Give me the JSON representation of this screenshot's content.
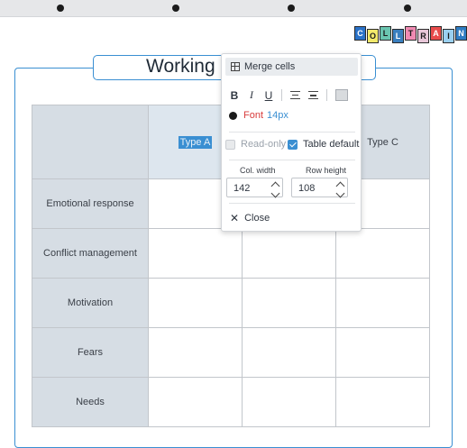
{
  "app": {
    "logo_letters": [
      {
        "ch": "C",
        "bg": "#2a72c8",
        "fg": "#ffffff"
      },
      {
        "ch": "O",
        "bg": "#f2e96b",
        "fg": "#1b1b1b"
      },
      {
        "ch": "L",
        "bg": "#6ac5b0",
        "fg": "#1b1b1b"
      },
      {
        "ch": "L",
        "bg": "#3a7fbf",
        "fg": "#ffffff"
      },
      {
        "ch": "T",
        "bg": "#f08ab2",
        "fg": "#1b1b1b"
      },
      {
        "ch": "R",
        "bg": "#e8c7d8",
        "fg": "#1b1b1b"
      },
      {
        "ch": "A",
        "bg": "#e84b4b",
        "fg": "#ffffff"
      },
      {
        "ch": "I",
        "bg": "#9ad0f0",
        "fg": "#1b1b1b"
      },
      {
        "ch": "N",
        "bg": "#2f7cc2",
        "fg": "#ffffff"
      }
    ]
  },
  "worksheet": {
    "title": "Working",
    "columns": [
      "",
      "Type A",
      "",
      "Type C"
    ],
    "rows": [
      {
        "label": "Emotional response"
      },
      {
        "label": "Conflict management"
      },
      {
        "label": "Motivation"
      },
      {
        "label": "Fears"
      },
      {
        "label": "Needs"
      }
    ]
  },
  "popup": {
    "merge_label": "Merge cells",
    "format_buttons": {
      "bold": "B",
      "italic": "I",
      "underline": "U"
    },
    "font_label": "Font",
    "font_size": "14px",
    "readonly_label": "Read-only",
    "readonly_checked": false,
    "table_default_label": "Table default",
    "table_default_checked": true,
    "col_width_label": "Col. width",
    "col_width_value": "142",
    "row_height_label": "Row height",
    "row_height_value": "108",
    "close_label": "Close"
  },
  "colors": {
    "accent": "#3a8fd2",
    "header_fill": "#d6dde4",
    "font_color_text": "#d83b3b"
  }
}
